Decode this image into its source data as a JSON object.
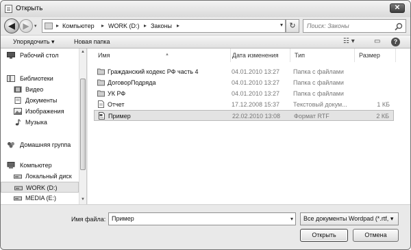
{
  "window": {
    "title": "Открыть",
    "close_glyph": "✕"
  },
  "nav": {
    "back_glyph": "◀",
    "forward_glyph": "▶",
    "history_glyph": "▾",
    "breadcrumb": [
      "Компьютер",
      "WORK (D:)",
      "Законы"
    ],
    "separator_glyph": "▸",
    "dropdown_glyph": "▾",
    "refresh_glyph": "↻",
    "search_placeholder": "Поиск: Законы"
  },
  "toolbar": {
    "organize_label": "Упорядочить ▾",
    "new_folder_label": "Новая папка",
    "views_glyph": "☷ ▾",
    "preview_glyph": "▭",
    "help_glyph": "?"
  },
  "sidebar": {
    "items": [
      {
        "label": "Рабочий стол",
        "icon": "desktop-icon"
      },
      {
        "label": "Библиотеки",
        "icon": "libraries-icon"
      },
      {
        "label": "Видео",
        "icon": "video-icon"
      },
      {
        "label": "Документы",
        "icon": "documents-icon"
      },
      {
        "label": "Изображения",
        "icon": "pictures-icon"
      },
      {
        "label": "Музыка",
        "icon": "music-icon"
      },
      {
        "label": "Домашняя группа",
        "icon": "homegroup-icon"
      },
      {
        "label": "Компьютер",
        "icon": "computer-icon"
      },
      {
        "label": "Локальный диск",
        "icon": "drive-icon"
      },
      {
        "label": "WORK (D:)",
        "icon": "drive-icon"
      },
      {
        "label": "MEDIA (E:)",
        "icon": "drive-icon"
      }
    ],
    "selected_index": 9,
    "scroll_up_glyph": "▲",
    "scroll_down_glyph": "▼"
  },
  "table": {
    "columns": [
      "Имя",
      "Дата изменения",
      "Тип",
      "Размер"
    ],
    "sort_glyph": "▲",
    "rows": [
      {
        "name": "Гражданский кодекс РФ часть 4",
        "date": "04.01.2010 13:27",
        "type": "Папка с файлами",
        "size": "",
        "icon": "folder-icon"
      },
      {
        "name": "ДоговорПодряда",
        "date": "04.01.2010 13:27",
        "type": "Папка с файлами",
        "size": "",
        "icon": "folder-icon"
      },
      {
        "name": "УК РФ",
        "date": "04.01.2010 13:27",
        "type": "Папка с файлами",
        "size": "",
        "icon": "folder-icon"
      },
      {
        "name": "Отчет",
        "date": "17.12.2008 15:37",
        "type": "Текстовый докум...",
        "size": "1 КБ",
        "icon": "text-file-icon"
      },
      {
        "name": "Пример",
        "date": "22.02.2010 13:08",
        "type": "Формат RTF",
        "size": "2 КБ",
        "icon": "rtf-file-icon"
      }
    ],
    "selected_index": 4
  },
  "footer": {
    "filename_label": "Имя файла:",
    "filename_value": "Пример",
    "filename_dropdown_glyph": "▾",
    "filter_value": "Все документы Wordpad (*.rtf, ▾",
    "open_label": "Открыть",
    "cancel_label": "Отмена"
  },
  "colors": {
    "window_bg": "#e9e9e9",
    "selection_bg": "#e3e3e3",
    "secondary_text": "#777777"
  }
}
